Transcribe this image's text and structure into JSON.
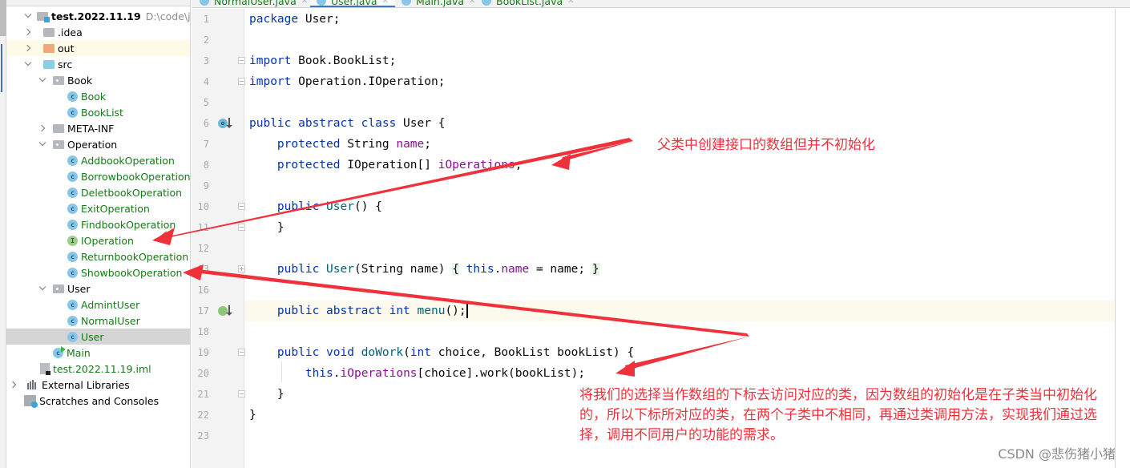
{
  "project_panel": {
    "root": {
      "name": "test.2022.11.19",
      "path": "D:\\code\\java_-cc"
    },
    "items": [
      {
        "label": ".idea",
        "type": "folder",
        "expanded": false
      },
      {
        "label": "out",
        "type": "folder-excluded",
        "expanded": false
      },
      {
        "label": "src",
        "type": "source-folder",
        "expanded": true
      },
      {
        "label": "Book",
        "type": "package",
        "expanded": true
      },
      {
        "label": "Book",
        "type": "class"
      },
      {
        "label": "BookList",
        "type": "class"
      },
      {
        "label": "META-INF",
        "type": "folder",
        "expanded": false
      },
      {
        "label": "Operation",
        "type": "package",
        "expanded": true
      },
      {
        "label": "AddbookOperation",
        "type": "class"
      },
      {
        "label": "BorrowbookOperation",
        "type": "class"
      },
      {
        "label": "DeletbookOperation",
        "type": "class"
      },
      {
        "label": "ExitOperation",
        "type": "class"
      },
      {
        "label": "FindbookOperation",
        "type": "class"
      },
      {
        "label": "IOperation",
        "type": "interface"
      },
      {
        "label": "ReturnbookOperation",
        "type": "class"
      },
      {
        "label": "ShowbookOperation",
        "type": "class"
      },
      {
        "label": "User",
        "type": "package",
        "expanded": true
      },
      {
        "label": "AdmintUser",
        "type": "class"
      },
      {
        "label": "NormalUser",
        "type": "class"
      },
      {
        "label": "User",
        "type": "class",
        "selected": true
      },
      {
        "label": "Main",
        "type": "main-class"
      },
      {
        "label": "test.2022.11.19.iml",
        "type": "iml-file"
      },
      {
        "label": "External Libraries",
        "type": "libraries",
        "expanded": false
      },
      {
        "label": "Scratches and Consoles",
        "type": "scratches"
      }
    ]
  },
  "tabs": [
    {
      "label": "NormalUser.java",
      "active": false
    },
    {
      "label": "User.java",
      "active": true
    },
    {
      "label": "Main.java",
      "active": false
    },
    {
      "label": "BookList.java",
      "active": false
    }
  ],
  "editor": {
    "line_numbers": [
      "1",
      "2",
      "3",
      "4",
      "5",
      "6",
      "7",
      "8",
      "9",
      "10",
      "11",
      "12",
      "13",
      "16",
      "17",
      "18",
      "19",
      "20",
      "21",
      "22",
      "23"
    ],
    "lines": {
      "l1": {
        "kw": "package",
        "rest": " User;"
      },
      "l3": {
        "kw": "import",
        "rest": " Book.BookList;"
      },
      "l4": {
        "kw": "import",
        "rest": " Operation.IOperation;"
      },
      "l6": {
        "kw": "public abstract class",
        "rest": " User {"
      },
      "l7": {
        "kw": "protected",
        "type": " String ",
        "field": "name",
        "end": ";"
      },
      "l8": {
        "kw": "protected",
        "type": " IOperation[] ",
        "field": "iOperations",
        "end": ";"
      },
      "l10": {
        "kw": "public",
        "fn": "User",
        "rest": "() {"
      },
      "l11": {
        "rest": "}"
      },
      "l13": {
        "kw": "public",
        "fn": "User",
        "params": "(String name) ",
        "b1": "{",
        "kw2": "this",
        "dot": ".",
        "field": "name",
        "assign": " = name; ",
        "b2": "}"
      },
      "l17": {
        "kw": "public abstract int",
        "fn": "menu",
        "rest": "();"
      },
      "l19": {
        "kw": "public void",
        "fn": "doWork",
        "p1": "(",
        "kw2": "int",
        "rest": " choice, BookList bookList) {"
      },
      "l20": {
        "kw": "this",
        "dot": ".",
        "field": "iOperations",
        "rest": "[choice].work(bookList);"
      },
      "l21": {
        "rest": "}"
      },
      "l22": {
        "rest": "}"
      }
    }
  },
  "annotations": {
    "note1": "父类中创建接口的数组但并不初始化",
    "note2": "将我们的选择当作数组的下标去访问对应的类，因为数组的初始化是在子类当中初始化的，所以下标所对应的类，在两个子类中不相同，再通过类调用方法，实现我们通过选择，调用不同用户的功能的需求。",
    "color": "#f0303a"
  },
  "watermark": "CSDN @悲伤猪小猪"
}
